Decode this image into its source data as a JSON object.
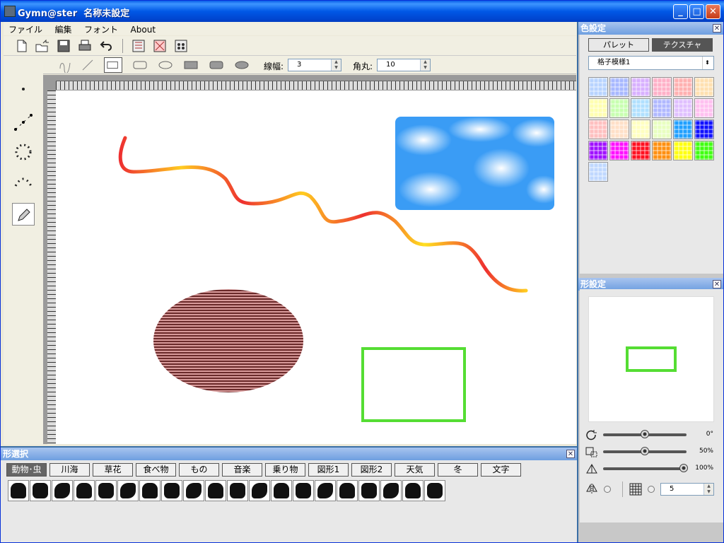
{
  "titlebar": {
    "app_name": "Gymn@ster",
    "doc_name": "名称未設定"
  },
  "menu": [
    "ファイル",
    "編集",
    "フォント",
    "About"
  ],
  "toolbar": {
    "icons": [
      "new-file-icon",
      "open-file-icon",
      "save-icon",
      "print-icon",
      "undo-icon",
      "color-settings-icon",
      "shape-settings-icon",
      "shape-select-icon"
    ]
  },
  "shape_tools": {
    "line_width_label": "線幅:",
    "line_width_value": "3",
    "corner_label": "角丸:",
    "corner_value": "10"
  },
  "left_tools": [
    "point-tool-icon",
    "line-tool-icon",
    "circle-dots-tool-icon",
    "arc-dots-tool-icon",
    "pencil-tool-icon"
  ],
  "color_panel": {
    "title": "色設定",
    "tabs": [
      "パレット",
      "テクスチャ"
    ],
    "active_tab": "テクスチャ",
    "texture_select": "格子模様1",
    "swatches": [
      "#b8d4ff",
      "#a8b8ff",
      "#d8b0ff",
      "#ffb0c8",
      "#ffb0b0",
      "#ffe0b0",
      "#ffffb0",
      "#c8ffb0",
      "#b0e0ff",
      "#b0b8ff",
      "#e0c0ff",
      "#ffc0f0",
      "#ffc0c0",
      "#ffe0c8",
      "#ffffc0",
      "#e8ffc0",
      "#20a0ff",
      "#1010ff",
      "#a010ff",
      "#ff10ff",
      "#ff1020",
      "#ff9010",
      "#ffff10",
      "#40ff10",
      "#c0d8ff"
    ]
  },
  "shape_panel": {
    "title": "形設定",
    "rotate_value": "0°",
    "scale_value": "50%",
    "opacity_value": "100%",
    "grid_value": "5"
  },
  "shape_select": {
    "title": "形選択",
    "categories": [
      "動物･虫",
      "川海",
      "草花",
      "食べ物",
      "もの",
      "音楽",
      "乗り物",
      "図形1",
      "図形2",
      "天気",
      "冬",
      "文字"
    ],
    "active_category": "動物･虫",
    "shapes": [
      "butterfly-icon",
      "moth-icon",
      "dragonfly-icon",
      "stag-beetle-icon",
      "beetle-icon",
      "grasshopper-icon",
      "bear-icon",
      "snail-icon",
      "dachshund-icon",
      "giraffe-icon",
      "bird-icon",
      "penguin-icon",
      "flying-bird-icon",
      "feather-icon",
      "paw-print-icon",
      "paw-icon",
      "footprint-icon",
      "hand-icon",
      "skull-icon",
      "bone-icon"
    ]
  }
}
